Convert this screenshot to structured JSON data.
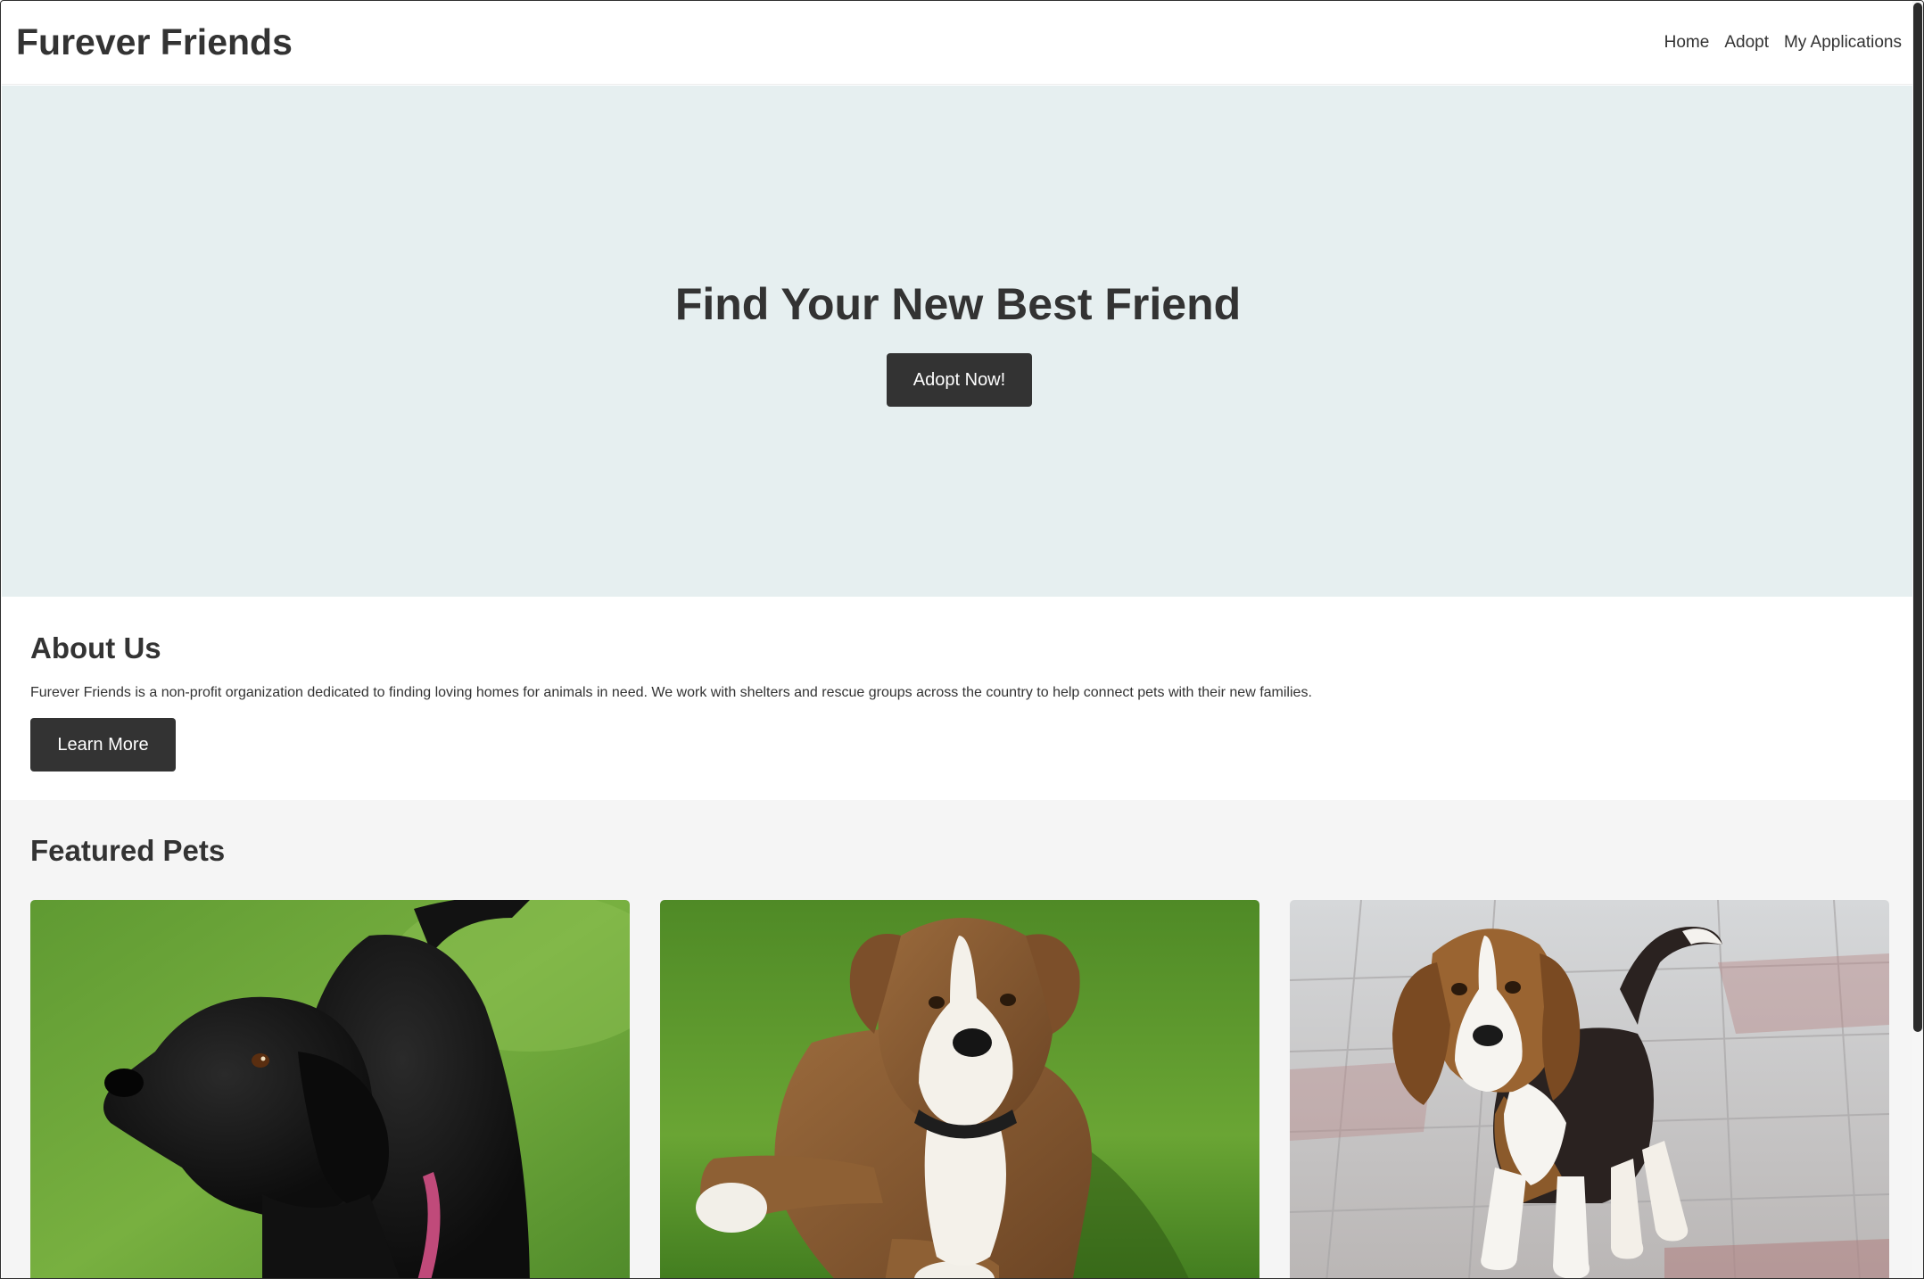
{
  "header": {
    "brand": "Furever Friends",
    "nav": [
      {
        "label": "Home"
      },
      {
        "label": "Adopt"
      },
      {
        "label": "My Applications"
      }
    ]
  },
  "hero": {
    "title": "Find Your New Best Friend",
    "button_label": "Adopt Now!",
    "background_color": "#e6eff0"
  },
  "about": {
    "heading": "About Us",
    "text": "Furever Friends is a non-profit organization dedicated to finding loving homes for animals in need. We work with shelters and rescue groups across the country to help connect pets with their new families.",
    "button_label": "Learn More"
  },
  "featured": {
    "heading": "Featured Pets",
    "pets": [
      {
        "image": "black-labrador-photo"
      },
      {
        "image": "brindle-boxer-puppy-photo"
      },
      {
        "image": "beagle-puppy-photo"
      }
    ]
  },
  "colors": {
    "button_bg": "#333333",
    "text": "#333333",
    "featured_bg": "#f5f5f5"
  }
}
